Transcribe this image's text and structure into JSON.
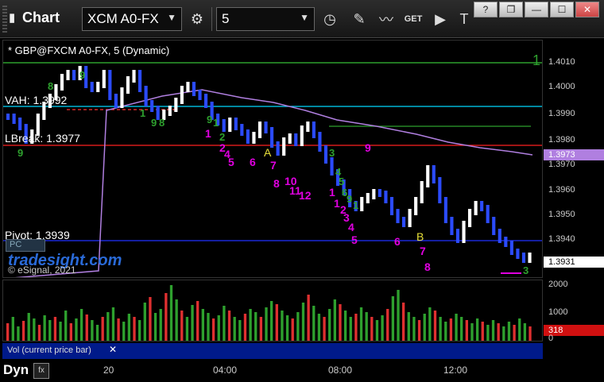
{
  "toolbar": {
    "title": "Chart",
    "symbol": "XCM A0-FX",
    "interval": "5",
    "icons": [
      "settings-gear-icon",
      "clock-icon",
      "pencil-icon",
      "study-icon",
      "get-icon",
      "play-icon",
      "text-tool-icon"
    ]
  },
  "window_controls": {
    "help": "?",
    "restore": "❐",
    "minimize": "—",
    "maximize": "☐",
    "close": "✕"
  },
  "series_title": "* GBP@FXCM A0-FX, 5 (Dynamic)",
  "levels": {
    "vah": "VAH: 1.3992",
    "lbreak": "LBreak: 1.3977",
    "pivot": "Pivot: 1.3939"
  },
  "watermark": "tradesight.com",
  "copyright": "© eSignal, 2021",
  "pc_tag": "PC",
  "price_axis": {
    "labels": [
      "1.4010",
      "1.4000",
      "1.3990",
      "1.3980",
      "1.3970",
      "1.3960",
      "1.3950",
      "1.3940"
    ],
    "current_price": "1.3931",
    "ma_value": "1.3973",
    "top_marker": "1"
  },
  "volume_axis": {
    "labels": [
      "2000",
      "1000",
      "0"
    ],
    "current": "318"
  },
  "volume_label": "Vol (current price bar)",
  "volume_close": "✕",
  "time_axis": {
    "dyn": "Dyn",
    "labels": [
      "20",
      "04:00",
      "08:00",
      "12:00"
    ]
  },
  "colors": {
    "up_bar": "#ffffff",
    "down_bar": "#2b4bff",
    "vah_line": "#00d8ff",
    "lbreak_line": "#ff2020",
    "pivot_line": "#2030ff",
    "ma_line": "#b07fe0",
    "green_line": "#2ea02e",
    "vol_up": "#2ea02e",
    "vol_down": "#e03030"
  },
  "markers": {
    "magenta": [
      "1",
      "2",
      "4",
      "5",
      "6",
      "7",
      "8",
      "10",
      "11",
      "12",
      "1",
      "1",
      "2",
      "3",
      "4",
      "5",
      "6",
      "7",
      "8",
      "9"
    ],
    "green": [
      "9",
      "8",
      "9",
      "1",
      "9",
      "8",
      "9",
      "1",
      "2",
      "3",
      "4",
      "5",
      "6",
      "9",
      "1",
      "3"
    ],
    "yellow": [
      "A",
      "B"
    ]
  }
}
